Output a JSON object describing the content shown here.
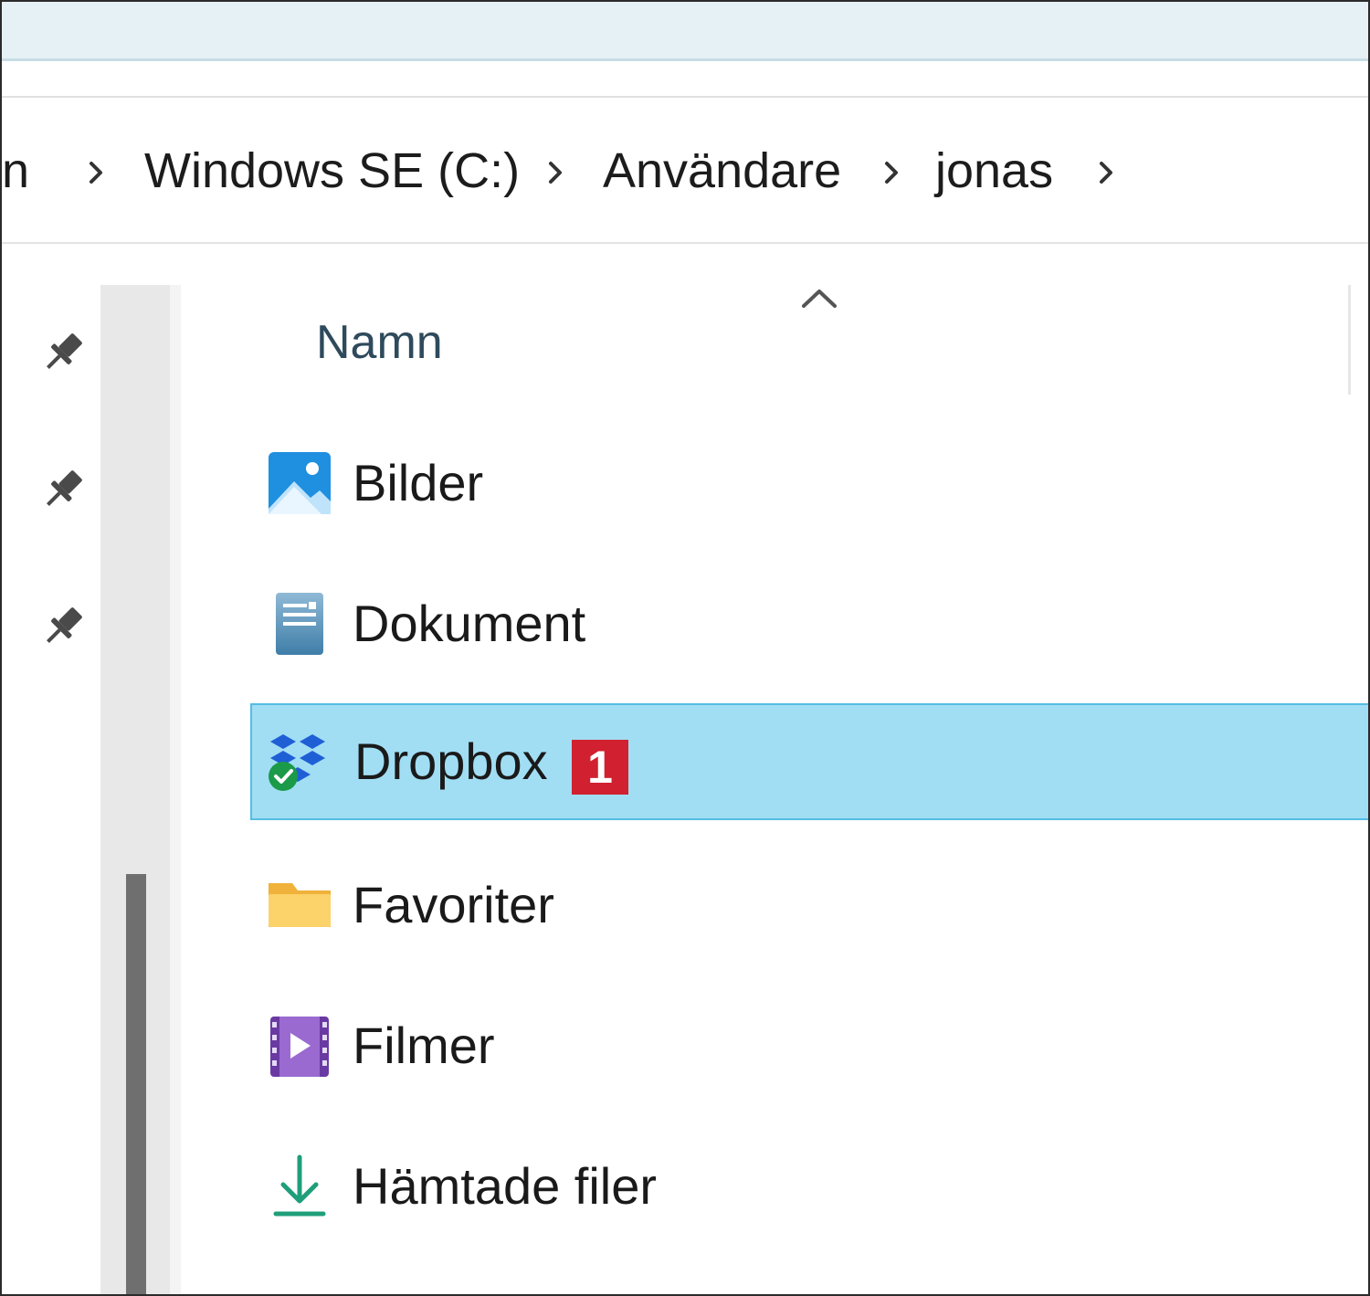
{
  "breadcrumb": {
    "items": [
      {
        "label": "rn"
      },
      {
        "label": "Windows SE (C:)"
      },
      {
        "label": "Användare"
      },
      {
        "label": "jonas"
      }
    ]
  },
  "file_list": {
    "column_header": "Namn",
    "sort_direction": "ascending",
    "items": [
      {
        "label": "Bilder",
        "icon": "pictures-folder-icon"
      },
      {
        "label": "Dokument",
        "icon": "documents-folder-icon"
      },
      {
        "label": "Dropbox",
        "icon": "dropbox-icon",
        "selected": true,
        "badge": "1",
        "sync_status": "synced"
      },
      {
        "label": "Favoriter",
        "icon": "folder-icon"
      },
      {
        "label": "Filmer",
        "icon": "videos-folder-icon"
      },
      {
        "label": "Hämtade filer",
        "icon": "downloads-icon"
      }
    ]
  },
  "colors": {
    "selection_fill": "#a1def4",
    "selection_border": "#55bde3",
    "badge": "#d1202f"
  }
}
